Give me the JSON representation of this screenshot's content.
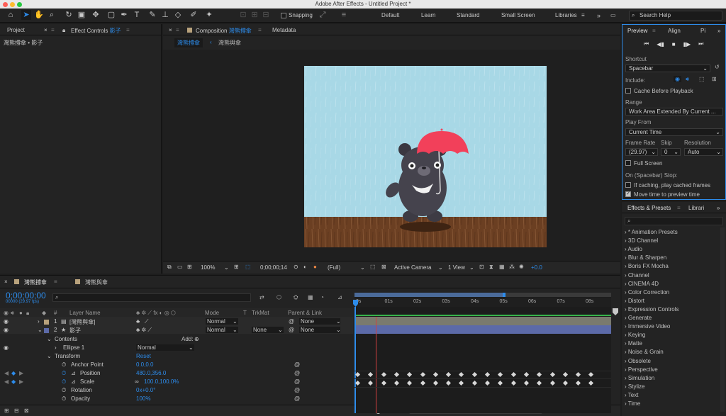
{
  "app": {
    "title": "Adobe After Effects - Untitled Project *"
  },
  "toolbar": {
    "snapping_label": "Snapping",
    "workspaces": [
      "Default",
      "Learn",
      "Standard",
      "Small Screen",
      "Libraries"
    ],
    "search_placeholder": "Search Help"
  },
  "left_panel": {
    "tabs": [
      "Project",
      "Effect Controls"
    ],
    "effect_controls_layer": "影子",
    "breadcrumb": "灣熊撐傘 • 影子"
  },
  "comp_panel": {
    "tabs": [
      "Composition",
      "Metadata"
    ],
    "composition_name": "灣熊撐傘",
    "flow_items": [
      "灣熊撐傘",
      "灣熊與傘"
    ],
    "bottom_bar": {
      "zoom": "100%",
      "timecode": "0;00;00;14",
      "resolution": "(Full)",
      "camera": "Active Camera",
      "views": "1 View",
      "exposure": "+0.0"
    }
  },
  "preview_panel": {
    "tabs": [
      "Preview",
      "Align",
      "Pi"
    ],
    "shortcut_label": "Shortcut",
    "shortcut_value": "Spacebar",
    "include_label": "Include:",
    "cache_before_playback": "Cache Before Playback",
    "range_label": "Range",
    "range_value": "Work Area Extended By Current ...",
    "play_from_label": "Play From",
    "play_from_value": "Current Time",
    "frame_rate_label": "Frame Rate",
    "skip_label": "Skip",
    "resolution_label": "Resolution",
    "frame_rate_value": "(29.97)",
    "skip_value": "0",
    "resolution_value": "Auto",
    "full_screen": "Full Screen",
    "stop_label": "On (Spacebar) Stop:",
    "if_caching": "If caching, play cached frames",
    "move_time": "Move time to preview time",
    "cache_before_playback_checked": false,
    "full_screen_checked": false,
    "if_caching_checked": false,
    "move_time_checked": true
  },
  "effects_panel": {
    "tabs": [
      "Effects & Presets",
      "Librari"
    ],
    "items": [
      "* Animation Presets",
      "3D Channel",
      "Audio",
      "Blur & Sharpen",
      "Boris FX Mocha",
      "Channel",
      "CINEMA 4D",
      "Color Correction",
      "Distort",
      "Expression Controls",
      "Generate",
      "Immersive Video",
      "Keying",
      "Matte",
      "Noise & Grain",
      "Obsolete",
      "Perspective",
      "Simulation",
      "Stylize",
      "Text",
      "Time"
    ]
  },
  "timeline": {
    "tabs": [
      "灣熊撐傘",
      "灣熊與傘"
    ],
    "timecode": "0;00;00;00",
    "fps": "00000 (29.97 fps)",
    "columns": {
      "num": "#",
      "layer_name": "Layer Name",
      "mode": "Mode",
      "t": "T",
      "trkmat": "TrkMat",
      "parent": "Parent & Link"
    },
    "ruler": [
      "0s",
      "01s",
      "02s",
      "03s",
      "04s",
      "05s",
      "06s",
      "07s",
      "08s"
    ],
    "layers": [
      {
        "num": "1",
        "name": "[灣熊與傘]",
        "mode": "Normal",
        "trkmat": "",
        "parent": "None"
      },
      {
        "num": "2",
        "name": "影子",
        "mode": "Normal",
        "trkmat": "None",
        "parent": "None"
      }
    ],
    "contents_label": "Contents",
    "add_label": "Add:",
    "ellipse_label": "Ellipse 1",
    "ellipse_mode": "Normal",
    "transform_label": "Transform",
    "reset_label": "Reset",
    "properties": [
      {
        "name": "Anchor Point",
        "value": "0.0,0.0"
      },
      {
        "name": "Position",
        "value": "480.0,356.0"
      },
      {
        "name": "Scale",
        "value": "100.0,100.0%"
      },
      {
        "name": "Rotation",
        "value": "0x+0.0°"
      },
      {
        "name": "Opacity",
        "value": "100%"
      }
    ],
    "position_keyframes": 19,
    "scale_keyframes": 19
  },
  "colors": {
    "accent": "#2d8ceb",
    "sky": "#a8d8e6",
    "floor": "#6b3f22",
    "umbrella": "#f2405a",
    "layer1_bar": "#7a7a6e",
    "layer2_bar": "#5c6aa8"
  }
}
